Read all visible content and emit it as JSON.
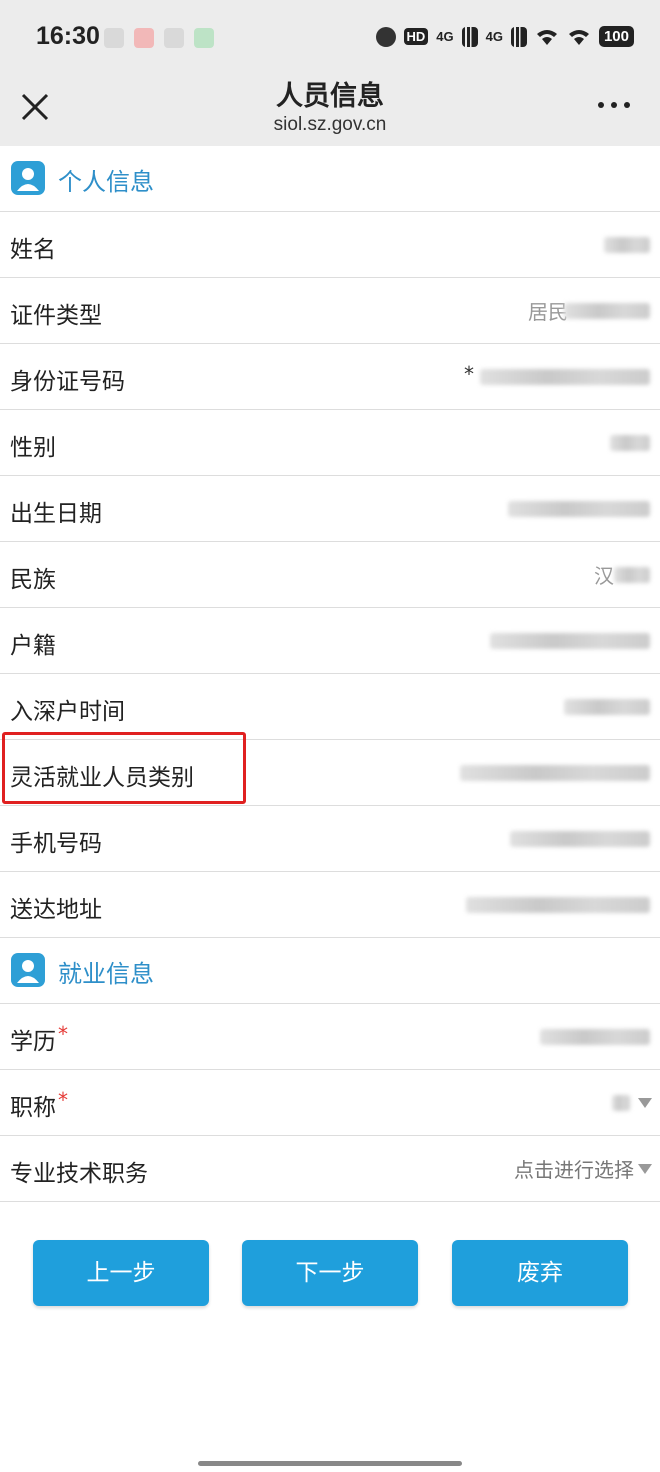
{
  "status_bar": {
    "time": "16:30",
    "battery": "100",
    "hd_label": "HD",
    "network1": "4G",
    "network2": "4G"
  },
  "nav": {
    "title": "人员信息",
    "url": "siol.sz.gov.cn",
    "close_icon": "close-icon",
    "more_icon": "more-icon"
  },
  "sections": {
    "personal": {
      "title": "个人信息"
    },
    "employment": {
      "title": "就业信息"
    }
  },
  "personal_fields": [
    {
      "label": "姓名"
    },
    {
      "label": "证件类型",
      "value_prefix": "居民"
    },
    {
      "label": "身份证号码",
      "value_prefix": "*"
    },
    {
      "label": "性别"
    },
    {
      "label": "出生日期"
    },
    {
      "label": "民族",
      "value_prefix": "汉"
    },
    {
      "label": "户籍"
    },
    {
      "label": "入深户时间"
    },
    {
      "label": "灵活就业人员类别"
    },
    {
      "label": "手机号码"
    },
    {
      "label": "送达地址"
    }
  ],
  "employment_fields": [
    {
      "label": "学历",
      "required": "*"
    },
    {
      "label": "职称",
      "required": "*"
    },
    {
      "label": "专业技术职务",
      "placeholder": "点击进行选择"
    }
  ],
  "buttons": {
    "prev": "上一步",
    "next": "下一步",
    "discard": "废弃"
  },
  "colors": {
    "accent": "#1f9fdc",
    "section_title": "#2e8fc9",
    "highlight": "#e02020",
    "required": "#e53935"
  }
}
